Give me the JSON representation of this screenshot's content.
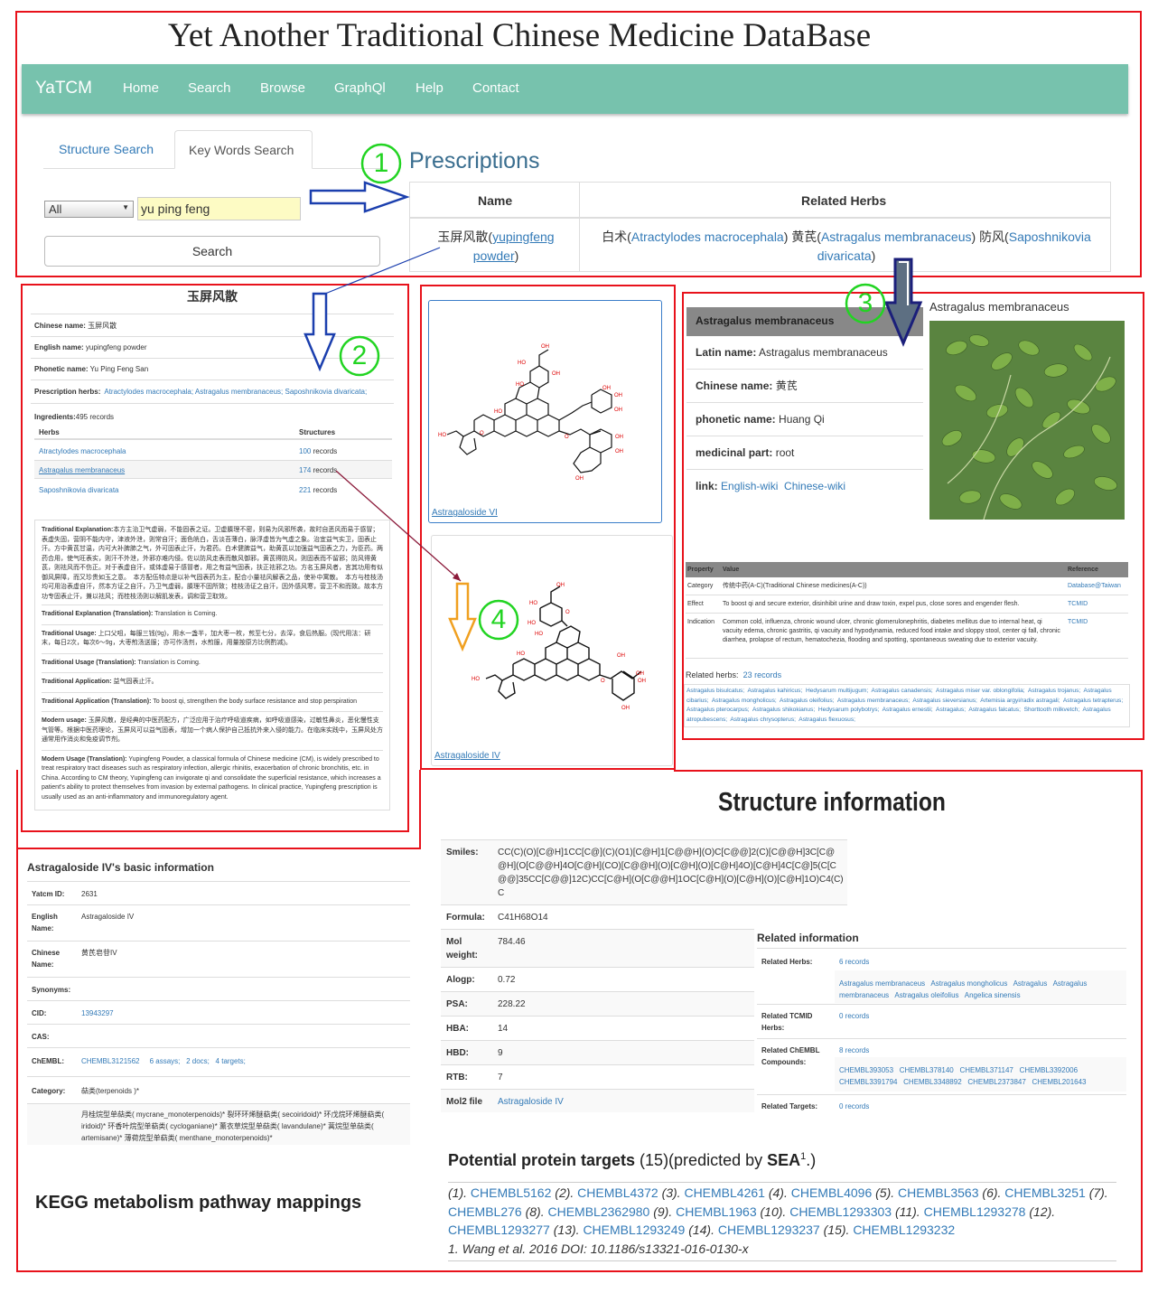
{
  "title": "Yet Another Traditional Chinese Medicine DataBase",
  "navbar": {
    "brand": "YaTCM",
    "items": [
      "Home",
      "Search",
      "Browse",
      "GraphQl",
      "Help",
      "Contact"
    ]
  },
  "search": {
    "tabs": [
      "Structure Search",
      "Key Words Search"
    ],
    "select_value": "All",
    "input_value": "yu ping feng",
    "button_label": "Search"
  },
  "markers": [
    "1",
    "2",
    "3",
    "4"
  ],
  "prescriptions": {
    "heading": "Prescriptions",
    "headers": [
      "Name",
      "Related Herbs"
    ],
    "name_cn": "玉屏风散(",
    "name_link": "yupingfeng powder",
    "name_close": ")",
    "herbs": [
      {
        "cn": "白术(",
        "latin": "Atractylodes macrocephala",
        "close": ") "
      },
      {
        "cn": "黄芪(",
        "latin": "Astragalus membranaceus",
        "close": ") "
      },
      {
        "cn": "防风(",
        "latin": "Saposhnikovia divaricata",
        "close": ")"
      }
    ]
  },
  "prescription_detail": {
    "title": "玉屏风散",
    "rows": [
      {
        "label": "Chinese name:",
        "value": "玉屏风散"
      },
      {
        "label": "English name:",
        "value": "yupingfeng powder"
      },
      {
        "label": "Phonetic name:",
        "value": "Yu Ping Feng San"
      }
    ],
    "herbs_label": "Prescription herbs:",
    "herbs_links": [
      "Atractylodes macrocephala;",
      "Astragalus membranaceus;",
      "Saposhnikovia divaricata;"
    ],
    "ingredients_label": "Ingredients:",
    "ingredients_value": "495 records",
    "table_headers": [
      "Herbs",
      "Structures"
    ],
    "table_rows": [
      {
        "herb": "Atractylodes macrocephala",
        "count": "100",
        "unit": "records"
      },
      {
        "herb": "Astragalus membranaceus",
        "count": "174",
        "unit": "records"
      },
      {
        "herb": "Saposhnikovia divaricata",
        "count": "221",
        "unit": "records"
      }
    ],
    "texts": [
      {
        "label": "Traditional Explanation:",
        "value": "本方主治卫气虚弱，不能固表之证。卫虚腠理不密，则易为风邪所袭，故时自恶风而易于感冒；表虚失固，营阴不能内守，津液外泄，则常自汗；面色㿠白，舌淡苔薄白，脉浮虚皆为气虚之象。治宜益气实卫，固表止汗。方中黄芪甘温，内可大补脾肺之气，外可固表止汗，为君药。白术健脾益气，助黄芪以加强益气固表之力，为臣药。两药合用，使气旺表实，则汗不外泄，外邪亦难内侵。佐以防风走表而散风御邪，黄芪得防风，则固表而不留邪；防风得黄芪，则祛风而不伤正。对于表虚自汗，或体虚易于感冒者，用之有益气固表，扶正祛邪之功。方名玉屏风者，言其功用有似御风屏障，而又珍贵如玉之意。　本方配伍特点是以补气固表药为主，配合小量祛风解表之品，使补中寓散。　本方与桂枝汤均可用治表虚自汗，然本方证之自汗，乃卫气虚弱，腠理不固所致；桂枝汤证之自汗，因外感风寒，营卫不和而致。故本方功专固表止汗，兼以祛风；而桂枝汤则以解肌发表，调和营卫取效。"
      },
      {
        "label": "Traditional Explanation (Translation):",
        "value": "Translation is Coming."
      },
      {
        "label": "Traditional Usage:",
        "value": "上口父咀，每服三钱(9g)，用水一盏半，加大枣一枚，煎至七分，去滓，食后热服。(现代用法：研末，每日2次，每次6～9g，大枣煎汤送服；亦可作汤剂，水煎服，用量按原方比例酌减)。"
      },
      {
        "label": "Traditional Usage (Translation):",
        "value": "Translation is Coming."
      },
      {
        "label": "Traditional Application:",
        "value": "益气固表止汗。"
      },
      {
        "label": "Traditional Application (Translation):",
        "value": "To boost qi, strengthen the body surface resistance and stop perspiration"
      },
      {
        "label": "Modern usage:",
        "value": "玉屏风散，是经典的中医药配方，广泛应用于治疗呼吸道疾病，如呼吸道感染，过敏性鼻炎，恶化慢性支气管等。根据中医药理论，玉屏风可以益气固表，增加一个病人保护自己抵抗外来入侵的能力。在临床实践中，玉屏风处方通常用作消炎和免疫调节剂。"
      },
      {
        "label": "Modern Usage (Translation):",
        "value": "Yupingfeng Powder, a classical formula of Chinese medicine (CM), is widely prescribed to treat respiratory tract diseases such as respiratory infection, allergic rhinitis, exacerbation of chronic bronchitis, etc. in China. According to CM theory, Yupingfeng can invigorate qi and consolidate the superficial resistance, which increases a patient's ability to protect themselves from invasion by external pathogens. In clinical practice, Yupingfeng prescription is usually used as an anti-inflammatory and immunoregulatory agent."
      }
    ]
  },
  "structures": [
    {
      "name": "Astragaloside VI"
    },
    {
      "name": "Astragaloside IV"
    }
  ],
  "herb_detail": {
    "header": "Astragalus membranaceus",
    "image_caption": "Astragalus membranaceus",
    "rows": [
      {
        "label": "Latin name:",
        "value": "Astragalus membranaceus"
      },
      {
        "label": "Chinese name:",
        "value": "黄芪"
      },
      {
        "label": "phonetic name:",
        "value": "Huang Qi"
      },
      {
        "label": "medicinal part:",
        "value": "root"
      }
    ],
    "link_label": "link:",
    "links": [
      "English-wiki",
      "Chinese-wiki"
    ],
    "prop_headers": [
      "Property",
      "Value",
      "Reference"
    ],
    "props": [
      {
        "property": "Category",
        "value": "传统中药(A-C)(Traditional Chinese medicines(A-C))",
        "ref": "Database@Taiwan"
      },
      {
        "property": "Effect",
        "value": "To boost qi and secure exterior, disinhibit urine and draw toxin, expel pus, close sores and engender flesh.",
        "ref": "TCMID"
      },
      {
        "property": "Indication",
        "value": "Common cold, influenza, chronic wound ulcer, chronic glomerulonephritis, diabetes mellitus due to internal heat, qi vacuity edema, chronic gastritis, qi vacuity and hypodynamia, reduced food intake and sloppy stool, center qi fall, chronic diarrhea, prolapse of rectum, hematochezia, flooding and spotting, spontaneous sweating due to exterior vacuity.",
        "ref": "TCMID"
      }
    ],
    "related_label": "Related herbs:",
    "related_count": "23 records",
    "related": [
      "Astragalus bisulcatus;",
      "Astragalus kahiricus;",
      "Hedysarum multijugum;",
      "Astragalus canadensis;",
      "Astragalus miser var. oblongifolia;",
      "Astragalus trojanus;",
      "Astragalus cibarius;",
      "Astragalus mongholicus;",
      "Astragalus oleifolius;",
      "Astragalus membranaceus;",
      "Astragalus sieversianus;",
      "Artemisia argyi/radix astragali;",
      "Astragalus tetrapterus;",
      "Astragalus pterocarpus;",
      "Astragalus shikokianus;",
      "Hedysarum polybotrys;",
      "Astragalus ernestii;",
      "Astragalus;",
      "Astragalus falcatus;",
      "Shorttooth milkvetch;",
      "Astragalus atropubescens;",
      "Astragalus chrysopterus;",
      "Astragalus flexuosus;"
    ]
  },
  "compound_basic": {
    "title": "Astragaloside IV's basic information",
    "rows": [
      {
        "label": "Yatcm ID:",
        "value": "2631"
      },
      {
        "label": "English Name:",
        "value": "Astragaloside IV"
      },
      {
        "label": "Chinese Name:",
        "value": "黄芪皂苷IV"
      },
      {
        "label": "Synonyms:",
        "value": ""
      },
      {
        "label": "CID:",
        "value": "13943297"
      },
      {
        "label": "CAS:",
        "value": ""
      },
      {
        "label": "ChEMBL:",
        "value": "CHEMBL3121562"
      }
    ],
    "chembl_extras": [
      "6 assays;",
      "2 docs;",
      "4 targets;"
    ],
    "category_label": "Category:",
    "category_value": "萜类(terpenoids )*",
    "category_detail": "月桂烷型单萜类( mycrane_monoterpenoids)*  裂环环烯醚萜类( secoiridoid)*  环戊烷环烯醚萜类( iridoid)*  环香叶烷型单萜类( cycloganiane)*  薰衣草烷型单萜类( lavandulane)*  蒿烷型单萜类( artemisane)*  薄荷烷型单萜类( menthane_monoterpenoids)*"
  },
  "kegg_title": "KEGG metabolism pathway mappings",
  "structure_info": {
    "title": "Structure information",
    "rows": [
      {
        "label": "Smiles:",
        "value": "CC(C)(O)[C@H]1CC[C@](C)(O1)[C@H]1[C@@H](O)C[C@@]2(C)[C@@H]3C[C@@H](O[C@@H]4O[C@H](CO)[C@@H](O)[C@H](O)[C@H]4O)[C@H]4C[C@]5(C[C@@]35CC[C@@]12C)CC[C@H](O[C@@H]1OC[C@H](O)[C@H](O)[C@H]1O)C4(C)C"
      },
      {
        "label": "Formula:",
        "value": "C41H68O14"
      },
      {
        "label": "Mol weight:",
        "value": "784.46"
      },
      {
        "label": "Alogp:",
        "value": "0.72"
      },
      {
        "label": "PSA:",
        "value": "228.22"
      },
      {
        "label": "HBA:",
        "value": "14"
      },
      {
        "label": "HBD:",
        "value": "9"
      },
      {
        "label": "RTB:",
        "value": "7"
      },
      {
        "label": "Mol2 file",
        "value": "Astragaloside IV"
      }
    ]
  },
  "related_info": {
    "title": "Related information",
    "herbs_label": "Related Herbs:",
    "herbs_count": "6 records",
    "herbs": [
      "Astragalus membranaceus",
      "Astragalus mongholicus",
      "Astragalus",
      "Astragalus membranaceus",
      "Astragalus oleifolius",
      "Angelica sinensis"
    ],
    "tcmid_label": "Related TCMID Herbs:",
    "tcmid_count": "0 records",
    "chembl_label": "Related ChEMBL Compounds:",
    "chembl_count": "8 records",
    "chembl": [
      "CHEMBL393053",
      "CHEMBL378140",
      "CHEMBL371147",
      "CHEMBL3392006",
      "CHEMBL3391794",
      "CHEMBL3348892",
      "CHEMBL2373847",
      "CHEMBL201643"
    ],
    "targets_label": "Related Targets:",
    "targets_count": "0 records"
  },
  "targets": {
    "title": "Potential protein targets",
    "count": "(15)(predicted by ",
    "sea": "SEA",
    "sup": "1",
    "tail": ".)",
    "items": [
      {
        "n": "(1).",
        "id": "CHEMBL5162"
      },
      {
        "n": "(2).",
        "id": "CHEMBL4372"
      },
      {
        "n": "(3).",
        "id": "CHEMBL4261"
      },
      {
        "n": "(4).",
        "id": "CHEMBL4096"
      },
      {
        "n": "(5).",
        "id": "CHEMBL3563"
      },
      {
        "n": "(6).",
        "id": "CHEMBL3251"
      },
      {
        "n": "(7).",
        "id": "CHEMBL276"
      },
      {
        "n": "(8).",
        "id": "CHEMBL2362980"
      },
      {
        "n": "(9).",
        "id": "CHEMBL1963"
      },
      {
        "n": "(10).",
        "id": "CHEMBL1293303"
      },
      {
        "n": "(11).",
        "id": "CHEMBL1293278"
      },
      {
        "n": "(12).",
        "id": "CHEMBL1293277"
      },
      {
        "n": "(13).",
        "id": "CHEMBL1293249"
      },
      {
        "n": "(14).",
        "id": "CHEMBL1293237"
      },
      {
        "n": "(15).",
        "id": "CHEMBL1293232"
      }
    ],
    "reference": "1. Wang et al. 2016 DOI: 10.1186/s13321-016-0130-x"
  }
}
